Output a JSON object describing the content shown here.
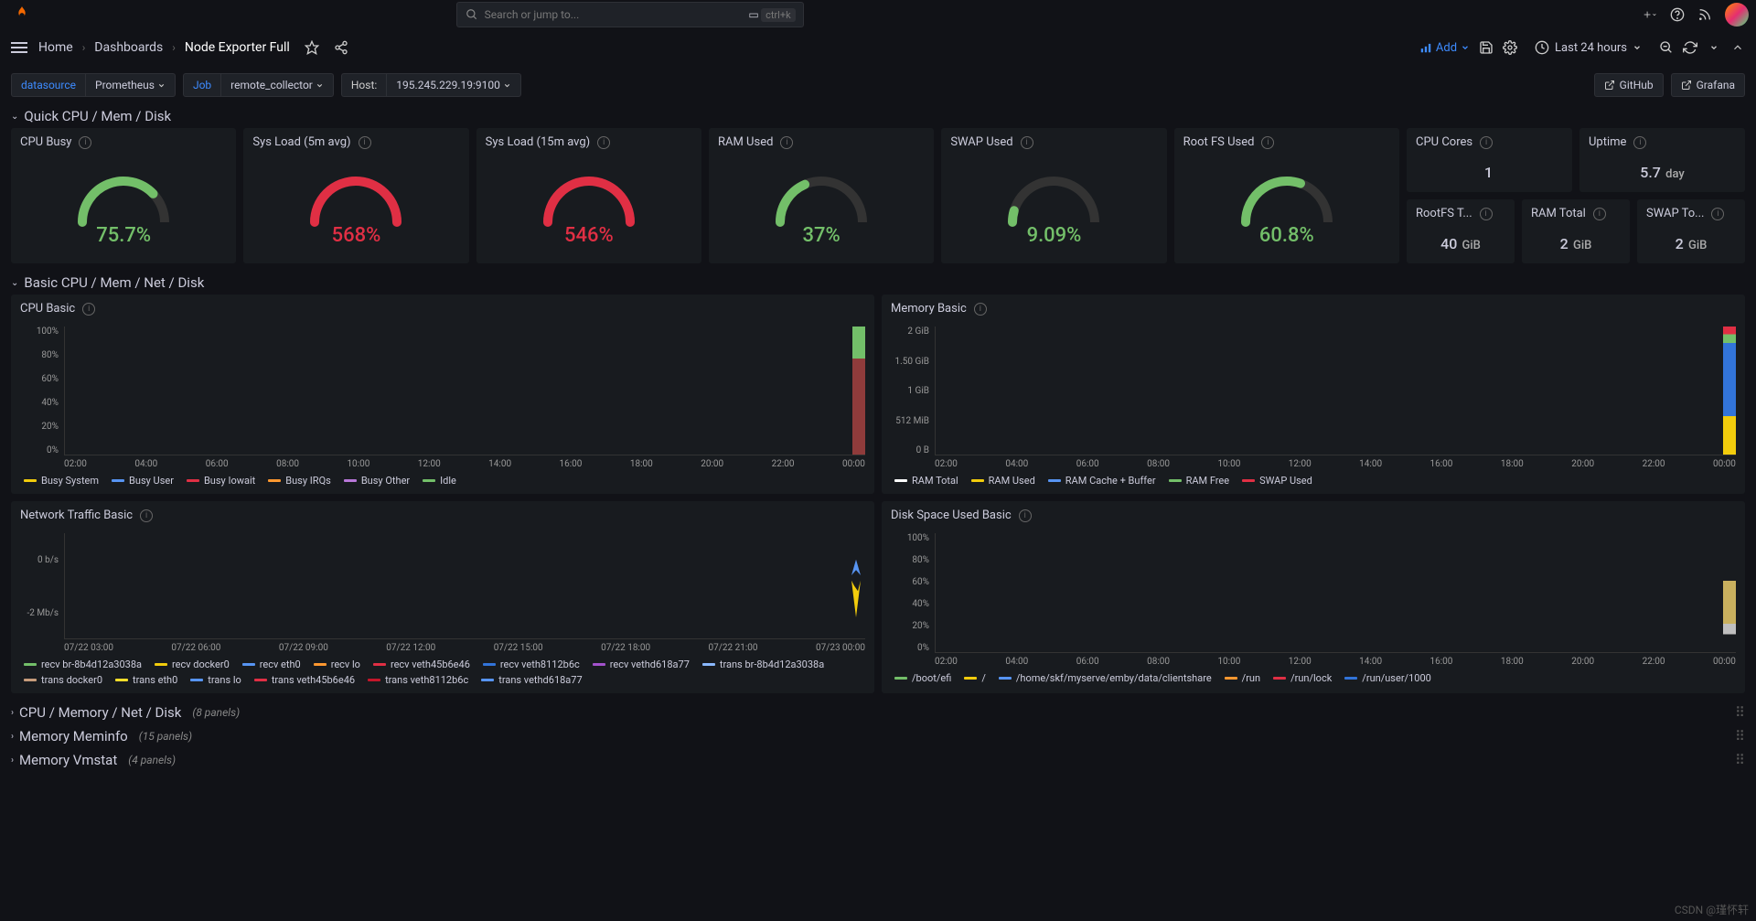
{
  "search_placeholder": "Search or jump to...",
  "search_kbd": "ctrl+k",
  "breadcrumbs": {
    "home": "Home",
    "dash": "Dashboards",
    "page": "Node Exporter Full"
  },
  "add_label": "Add",
  "time_label": "Last 24 hours",
  "vars": {
    "ds_label": "datasource",
    "ds_val": "Prometheus",
    "job_label": "Job",
    "job_val": "remote_collector",
    "host_label": "Host:",
    "host_val": "195.245.229.19:9100"
  },
  "links": {
    "github": "GitHub",
    "grafana": "Grafana"
  },
  "row1_title": "Quick CPU / Mem / Disk",
  "gauges": [
    {
      "title": "CPU Busy",
      "val": "75.7%",
      "color": "#73bf69",
      "pct": 75.7
    },
    {
      "title": "Sys Load (5m avg)",
      "val": "568%",
      "color": "#e02f44",
      "pct": 100
    },
    {
      "title": "Sys Load (15m avg)",
      "val": "546%",
      "color": "#e02f44",
      "pct": 100
    },
    {
      "title": "RAM Used",
      "val": "37%",
      "color": "#73bf69",
      "pct": 37
    },
    {
      "title": "SWAP Used",
      "val": "9.09%",
      "color": "#73bf69",
      "pct": 9.09
    },
    {
      "title": "Root FS Used",
      "val": "60.8%",
      "color": "#73bf69",
      "pct": 60.8
    }
  ],
  "stats_top": [
    {
      "title": "CPU Cores",
      "val": "1",
      "unit": ""
    },
    {
      "title": "Uptime",
      "val": "5.7",
      "unit": "day"
    }
  ],
  "stats_bot": [
    {
      "title": "RootFS T...",
      "val": "40",
      "unit": "GiB"
    },
    {
      "title": "RAM Total",
      "val": "2",
      "unit": "GiB"
    },
    {
      "title": "SWAP To...",
      "val": "2",
      "unit": "GiB"
    }
  ],
  "row2_title": "Basic CPU / Mem / Net / Disk",
  "graphs": {
    "cpu": {
      "title": "CPU Basic",
      "ylabels": [
        "100%",
        "80%",
        "60%",
        "40%",
        "20%",
        "0%"
      ],
      "xlabels": [
        "02:00",
        "04:00",
        "06:00",
        "08:00",
        "10:00",
        "12:00",
        "14:00",
        "16:00",
        "18:00",
        "20:00",
        "22:00",
        "00:00"
      ],
      "legend": [
        {
          "c": "#f2cc0c",
          "n": "Busy System"
        },
        {
          "c": "#5794f2",
          "n": "Busy User"
        },
        {
          "c": "#e02f44",
          "n": "Busy Iowait"
        },
        {
          "c": "#ff9830",
          "n": "Busy IRQs"
        },
        {
          "c": "#b877d9",
          "n": "Busy Other"
        },
        {
          "c": "#73bf69",
          "n": "Idle"
        }
      ]
    },
    "mem": {
      "title": "Memory Basic",
      "ylabels": [
        "2 GiB",
        "1.50 GiB",
        "1 GiB",
        "512 MiB",
        "0 B"
      ],
      "xlabels": [
        "02:00",
        "04:00",
        "06:00",
        "08:00",
        "10:00",
        "12:00",
        "14:00",
        "16:00",
        "18:00",
        "20:00",
        "22:00",
        "00:00"
      ],
      "legend": [
        {
          "c": "#ffffff",
          "n": "RAM Total"
        },
        {
          "c": "#f2cc0c",
          "n": "RAM Used"
        },
        {
          "c": "#5794f2",
          "n": "RAM Cache + Buffer"
        },
        {
          "c": "#73bf69",
          "n": "RAM Free"
        },
        {
          "c": "#e02f44",
          "n": "SWAP Used"
        }
      ]
    },
    "net": {
      "title": "Network Traffic Basic",
      "ylabels": [
        "",
        "0 b/s",
        "",
        "-2 Mb/s",
        ""
      ],
      "xlabels": [
        "07/22 03:00",
        "07/22 06:00",
        "07/22 09:00",
        "07/22 12:00",
        "07/22 15:00",
        "07/22 18:00",
        "07/22 21:00",
        "07/23 00:00"
      ],
      "legend": [
        {
          "c": "#73bf69",
          "n": "recv br-8b4d12a3038a"
        },
        {
          "c": "#f2cc0c",
          "n": "recv docker0"
        },
        {
          "c": "#5794f2",
          "n": "recv eth0"
        },
        {
          "c": "#ff9830",
          "n": "recv lo"
        },
        {
          "c": "#e02f44",
          "n": "recv veth45b6e46"
        },
        {
          "c": "#3274d9",
          "n": "recv veth8112b6c"
        },
        {
          "c": "#a352cc",
          "n": "recv vethd618a77"
        },
        {
          "c": "#8ab8ff",
          "n": "trans br-8b4d12a3038a"
        },
        {
          "c": "#c69b7b",
          "n": "trans docker0"
        },
        {
          "c": "#fade2a",
          "n": "trans eth0"
        },
        {
          "c": "#5794f2",
          "n": "trans lo"
        },
        {
          "c": "#e02f44",
          "n": "trans veth45b6e46"
        },
        {
          "c": "#c4162a",
          "n": "trans veth8112b6c"
        },
        {
          "c": "#5794f2",
          "n": "trans vethd618a77"
        }
      ]
    },
    "disk": {
      "title": "Disk Space Used Basic",
      "ylabels": [
        "100%",
        "80%",
        "60%",
        "40%",
        "20%",
        "0%"
      ],
      "xlabels": [
        "02:00",
        "04:00",
        "06:00",
        "08:00",
        "10:00",
        "12:00",
        "14:00",
        "16:00",
        "18:00",
        "20:00",
        "22:00",
        "00:00"
      ],
      "legend": [
        {
          "c": "#73bf69",
          "n": "/boot/efi"
        },
        {
          "c": "#f2cc0c",
          "n": "/"
        },
        {
          "c": "#5794f2",
          "n": "/home/skf/myserve/emby/data/clientshare"
        },
        {
          "c": "#ff9830",
          "n": "/run"
        },
        {
          "c": "#e02f44",
          "n": "/run/lock"
        },
        {
          "c": "#3274d9",
          "n": "/run/user/1000"
        }
      ]
    }
  },
  "collapsed_rows": [
    {
      "title": "CPU / Memory / Net / Disk",
      "cnt": "(8 panels)"
    },
    {
      "title": "Memory Meminfo",
      "cnt": "(15 panels)"
    },
    {
      "title": "Memory Vmstat",
      "cnt": "(4 panels)"
    }
  ],
  "watermark": "CSDN @瑾怀轩"
}
